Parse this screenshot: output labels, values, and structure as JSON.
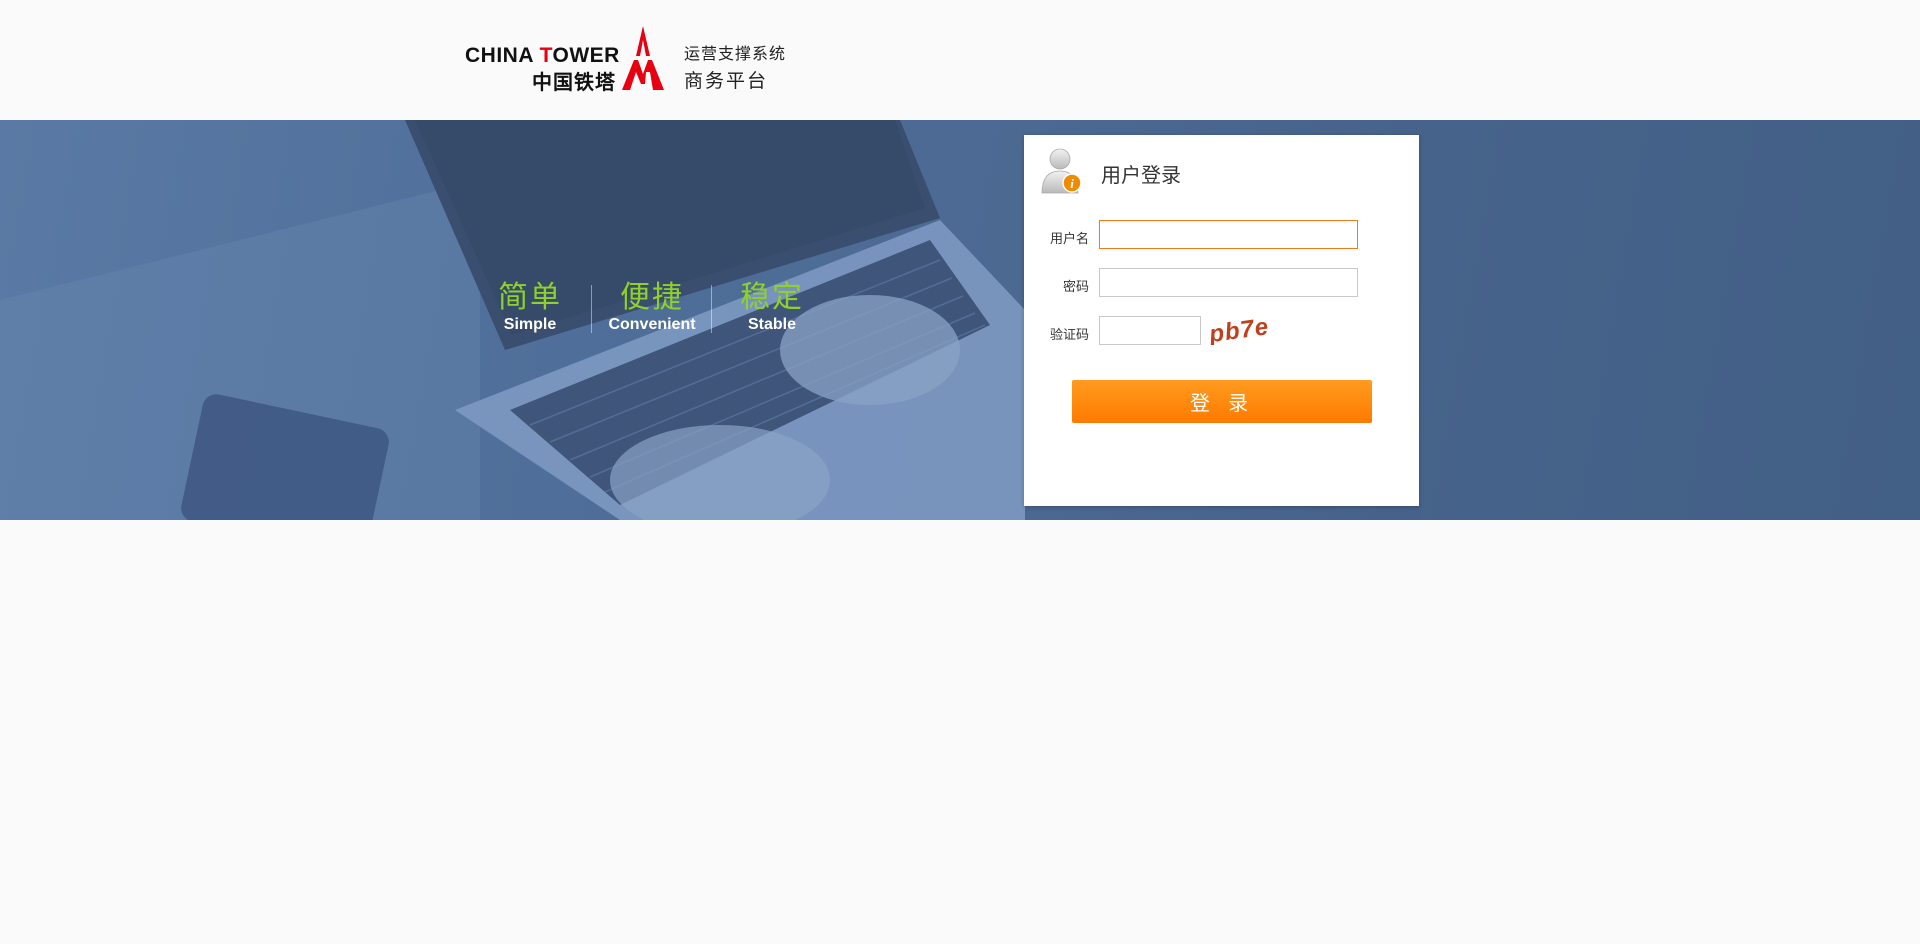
{
  "header": {
    "logo": {
      "en_prefix": "CHINA ",
      "en_t": "T",
      "en_rest": "OWER",
      "cn": "中国铁塔",
      "system_line1": "运营支撑系统",
      "system_line2": "商务平台"
    }
  },
  "banner": {
    "taglines": [
      {
        "cn": "简单",
        "en": "Simple"
      },
      {
        "cn": "便捷",
        "en": "Convenient"
      },
      {
        "cn": "稳定",
        "en": "Stable"
      }
    ]
  },
  "login": {
    "title": "用户登录",
    "username_label": "用户名",
    "username_value": "",
    "password_label": "密码",
    "password_value": "",
    "captcha_label": "验证码",
    "captcha_value": "",
    "captcha_text": "pb7e",
    "submit_label": "登 录"
  },
  "colors": {
    "brand_red": "#e60012",
    "accent_orange": "#ff8a00",
    "tagline_green": "#8fd12a",
    "banner_blue": "#4f6f9a"
  }
}
